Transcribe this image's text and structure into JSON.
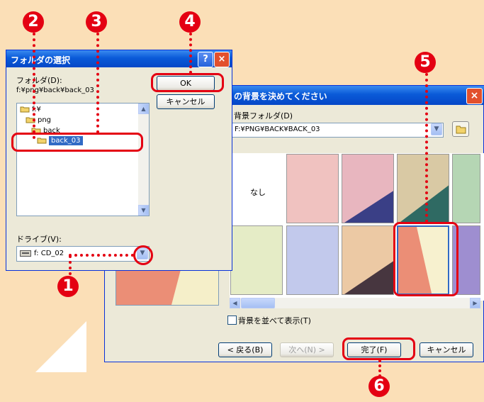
{
  "front_dialog": {
    "title": "フォルダの選択",
    "help_icon": "?",
    "close_icon": "×",
    "folder_label": "フォルダ(D):",
    "folder_path": "f:¥png¥back¥back_03",
    "tree_items": [
      "f:¥",
      "png",
      "back",
      "back_03"
    ],
    "drive_label": "ドライブ(V):",
    "drive_value": "f: CD_02",
    "ok_label": "OK",
    "cancel_label": "キャンセル"
  },
  "back_dialog": {
    "title_partial": "の背景を決めてください",
    "folder_label": "背景フォルダ(D)",
    "folder_value": "F:¥PNG¥BACK¥BACK_03",
    "none_label": "なし",
    "checkbox_label": "背景を並べて表示(T)",
    "back_label": "< 戻る(B)",
    "next_label": "次へ(N) >",
    "finish_label": "完了(F)",
    "cancel_label": "キャンセル"
  },
  "callouts": [
    "1",
    "2",
    "3",
    "4",
    "5",
    "6"
  ],
  "colors": {
    "page_bg": "#fbdfb7",
    "callout": "#e40012",
    "titlebar": "#0a5ad8",
    "dialog_face": "#ece9d8",
    "selection": "#316ac5"
  }
}
